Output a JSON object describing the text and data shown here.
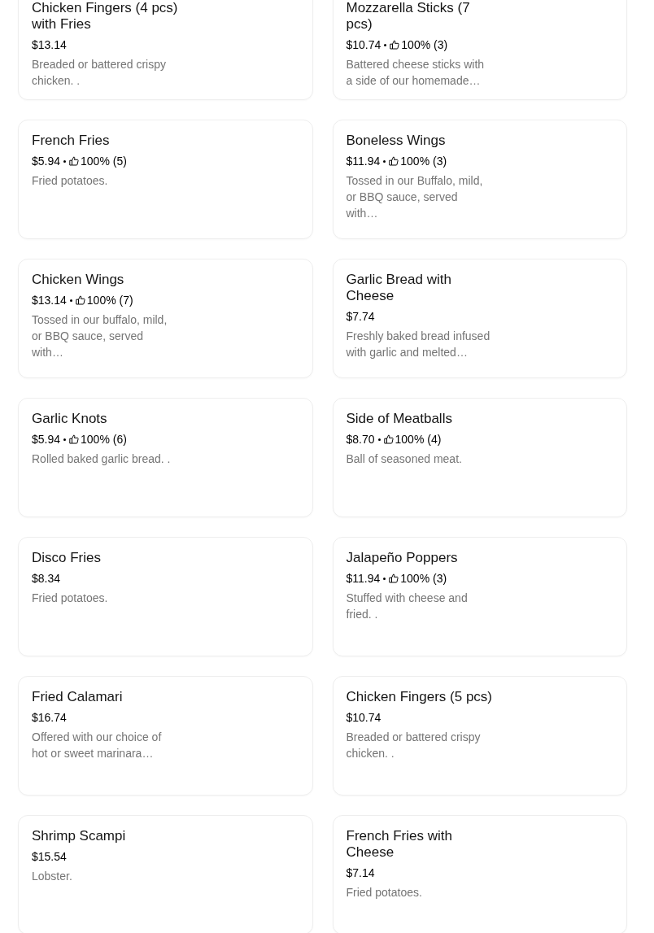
{
  "menu_items": [
    {
      "title": "Chicken Fingers (4 pcs) with Fries",
      "price": "$13.14",
      "description": "Breaded or battered crispy chicken. ."
    },
    {
      "title": "Mozzarella Sticks (7 pcs)",
      "price": "$10.74",
      "rating": "100% (3)",
      "description": "Battered cheese sticks with a side of our homemade…"
    },
    {
      "title": "French Fries",
      "price": "$5.94",
      "rating": "100% (5)",
      "description": "Fried potatoes."
    },
    {
      "title": "Boneless Wings",
      "price": "$11.94",
      "rating": "100% (3)",
      "description": "Tossed in our Buffalo, mild, or BBQ sauce, served with…"
    },
    {
      "title": "Chicken Wings",
      "price": "$13.14",
      "rating": "100% (7)",
      "description": "Tossed in our buffalo, mild, or BBQ sauce, served with…"
    },
    {
      "title": "Garlic Bread with Cheese",
      "price": "$7.74",
      "description": "Freshly baked bread infused with garlic and melted…"
    },
    {
      "title": "Garlic Knots",
      "price": "$5.94",
      "rating": "100% (6)",
      "description": "Rolled baked garlic bread. ."
    },
    {
      "title": "Side of Meatballs",
      "price": "$8.70",
      "rating": "100% (4)",
      "description": "Ball of seasoned meat."
    },
    {
      "title": "Disco Fries",
      "price": "$8.34",
      "description": "Fried potatoes."
    },
    {
      "title": "Jalapeño Poppers",
      "price": "$11.94",
      "rating": "100% (3)",
      "description": "Stuffed with cheese and fried. ."
    },
    {
      "title": "Fried Calamari",
      "price": "$16.74",
      "description": "Offered with our choice of hot or sweet marinara…"
    },
    {
      "title": "Chicken Fingers (5 pcs)",
      "price": "$10.74",
      "description": "Breaded or battered crispy chicken. ."
    },
    {
      "title": "Shrimp Scampi",
      "price": "$15.54",
      "description": "Lobster."
    },
    {
      "title": "French Fries with Cheese",
      "price": "$7.14",
      "description": "Fried potatoes."
    }
  ]
}
